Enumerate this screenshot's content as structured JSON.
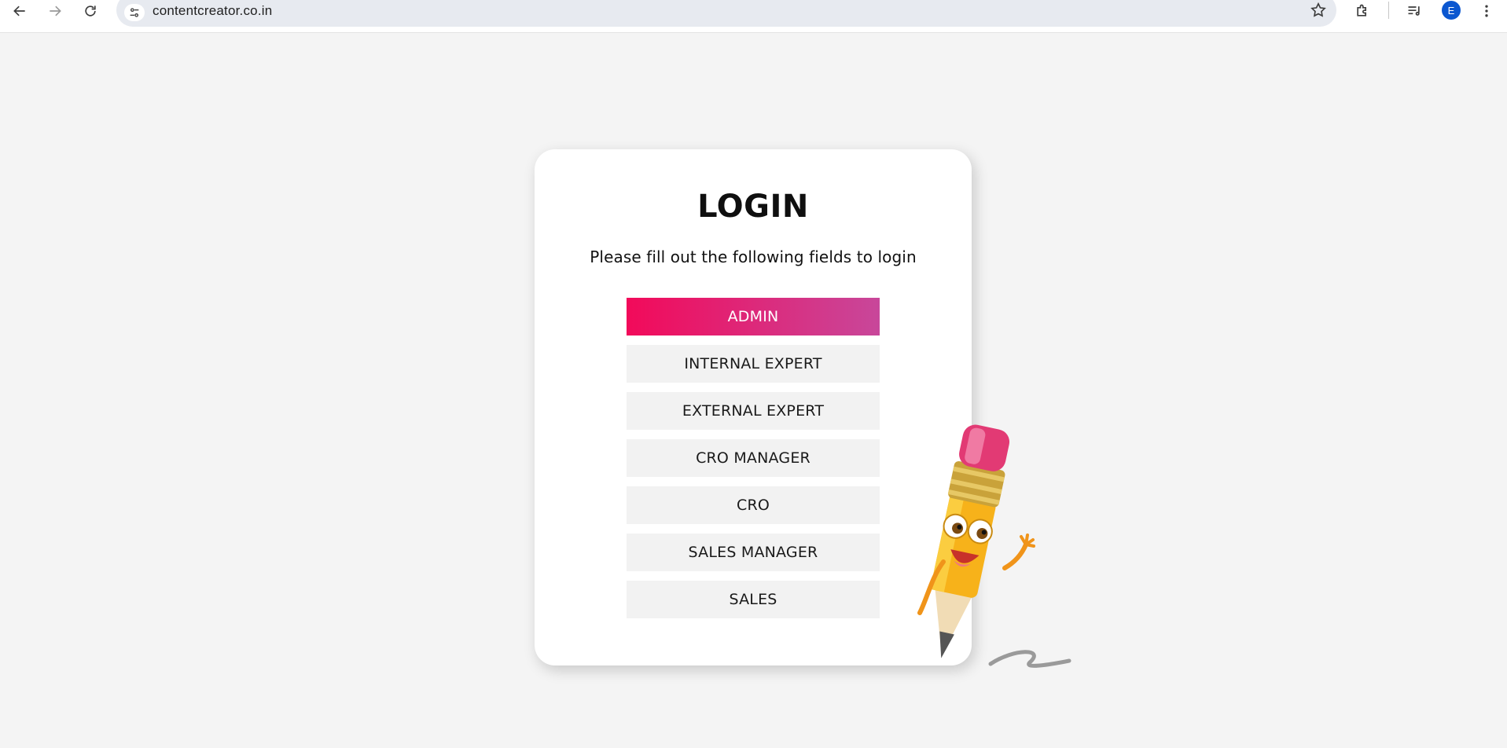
{
  "browser": {
    "url": "contentcreator.co.in",
    "profile_initial": "E",
    "accent_color": "#0b57d0"
  },
  "login": {
    "title": "LOGIN",
    "subtitle": "Please fill out the following fields to login",
    "roles": [
      {
        "label": "ADMIN",
        "selected": true
      },
      {
        "label": "INTERNAL EXPERT",
        "selected": false
      },
      {
        "label": "EXTERNAL EXPERT",
        "selected": false
      },
      {
        "label": "CRO MANAGER",
        "selected": false
      },
      {
        "label": "CRO",
        "selected": false
      },
      {
        "label": "SALES MANAGER",
        "selected": false
      },
      {
        "label": "SALES",
        "selected": false
      }
    ],
    "active_gradient": [
      "#f20a5a",
      "#c8479a"
    ]
  },
  "icons": {
    "back": "arrow-left-icon",
    "forward": "arrow-right-icon",
    "reload": "reload-icon",
    "site_settings": "tune-icon",
    "bookmark": "star-icon",
    "extensions": "puzzle-icon",
    "media": "media-queue-icon",
    "menu": "kebab-menu-icon",
    "mascot": "pencil-mascot-illustration"
  }
}
